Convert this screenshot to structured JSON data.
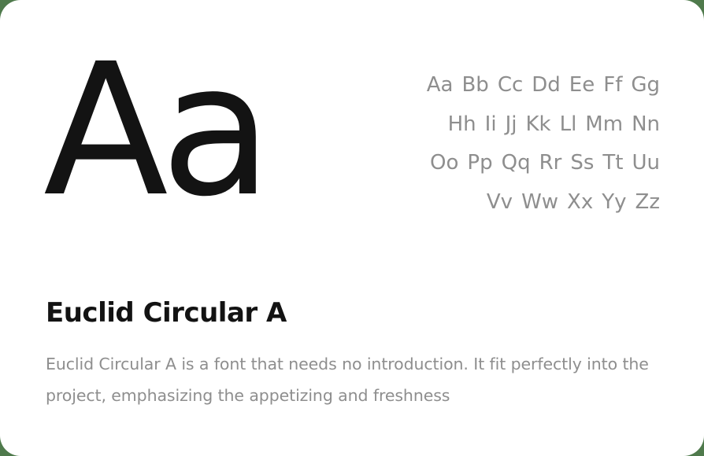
{
  "specimen": {
    "glyph": "Aa"
  },
  "alphabet": {
    "rows": [
      [
        "Aa",
        "Bb",
        "Cc",
        "Dd",
        "Ee",
        "Ff",
        "Gg"
      ],
      [
        "Hh",
        "Ii",
        "Jj",
        "Kk",
        "Ll",
        "Mm",
        "Nn"
      ],
      [
        "Oo",
        "Pp",
        "Qq",
        "Rr",
        "Ss",
        "Tt",
        "Uu"
      ],
      [
        "Vv",
        "Ww",
        "Xx",
        "Yy",
        "Zz"
      ]
    ]
  },
  "font": {
    "name": "Euclid Circular A",
    "description": "Euclid Circular A is a font that needs no introduction. It fit perfectly into the project, emphasizing the appetizing and freshness"
  },
  "colors": {
    "card_background": "#ffffff",
    "frame_background": "#4f7a4c",
    "heading_text": "#131313",
    "muted_text": "#8e8e8e"
  }
}
